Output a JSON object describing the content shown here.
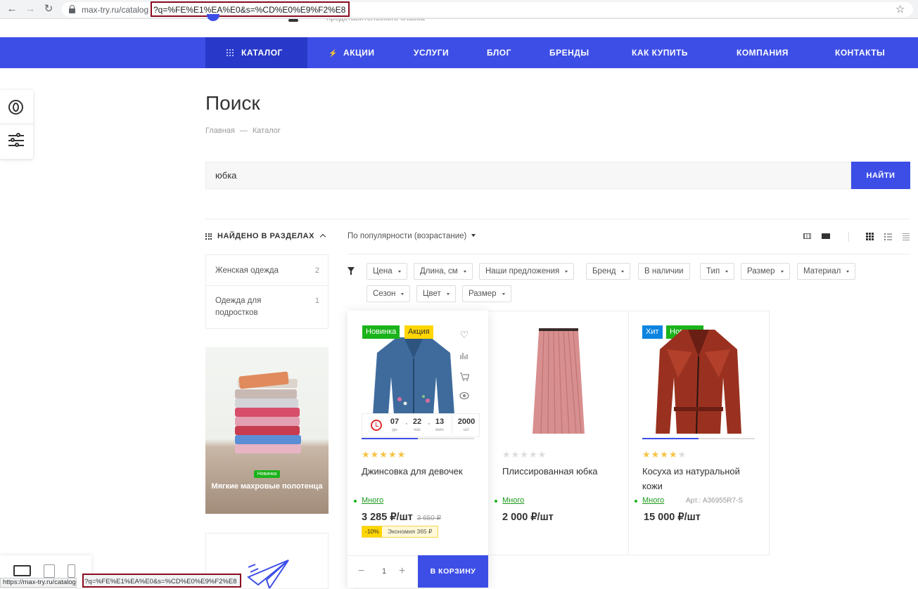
{
  "browser": {
    "url_base": "max-try.ru/catalog",
    "url_query": "?q=%FE%E1%EA%E0&s=%CD%E0%E9%F2%E8",
    "status_url_base": "https://max-try.ru/catalog",
    "status_url_query": "?q=%FE%E1%EA%E0&s=%CD%E0%E9%F2%E8"
  },
  "nav": {
    "catalog": "КАТАЛОГ",
    "items": [
      "АКЦИИ",
      "УСЛУГИ",
      "БЛОГ",
      "БРЕНДЫ",
      "КАК КУПИТЬ",
      "КОМПАНИЯ",
      "КОНТАКТЫ"
    ]
  },
  "page": {
    "title": "Поиск",
    "breadcrumb": [
      "Главная",
      "Каталог"
    ],
    "search_value": "юбка",
    "search_button": "НАЙТИ"
  },
  "sections": {
    "title": "НАЙДЕНО В РАЗДЕЛАХ",
    "items": [
      {
        "label": "Женская одежда",
        "count": "2"
      },
      {
        "label": "Одежда для подростков",
        "count": "1"
      }
    ]
  },
  "banner": {
    "badge": "Новинка",
    "text": "Мягкие махровые полотенца"
  },
  "sort": {
    "label": "По популярности (возрастание)"
  },
  "filters": [
    "Цена",
    "Длина, см",
    "Наши предложения",
    "Бренд",
    "В наличии",
    "Тип",
    "Размер",
    "Материал",
    "Сезон",
    "Цвет",
    "Размер"
  ],
  "products": [
    {
      "badges": [
        "Новинка",
        "Акция"
      ],
      "rating": 5,
      "name": "Джинсовка для девочек",
      "stock": "Много",
      "price": "3 285 ₽/шт",
      "old_price": "3 650 ₽",
      "discount_pct": "-10%",
      "discount_text": "Экономия 365 ₽",
      "timer": {
        "days": "07",
        "days_l": "дн",
        "hours": "22",
        "hours_l": "час",
        "mins": "13",
        "mins_l": "мин",
        "qty": "2000",
        "qty_l": "шт"
      },
      "quantity": "1",
      "cart_button": "В КОРЗИНУ"
    },
    {
      "badges": [],
      "rating": 0,
      "name": "Плиссированная юбка",
      "stock": "Много",
      "price": "2 000 ₽/шт"
    },
    {
      "badges": [
        "Хит",
        "Новинка"
      ],
      "rating": 4,
      "name": "Косуха из натуральной кожи",
      "stock": "Много",
      "article": "Арт.: A36955R7-S",
      "price": "15 000 ₽/шт"
    }
  ],
  "colors": {
    "accent": "#3d4ee6",
    "accent_dark": "#2838c8",
    "new": "#1ab31a",
    "sale": "#ffd600",
    "hit": "#0c84e0",
    "star": "#f6c343"
  }
}
